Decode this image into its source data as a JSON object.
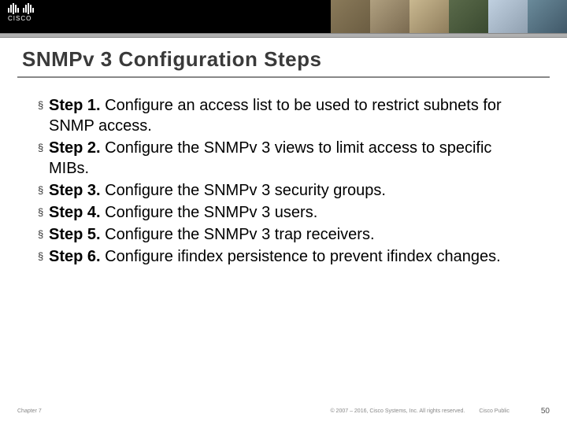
{
  "header": {
    "logo_text": "CISCO"
  },
  "title": "SNMPv 3 Configuration Steps",
  "steps": [
    {
      "label": "Step 1.",
      "body": " Configure an access list to be used to restrict subnets for SNMP access."
    },
    {
      "label": "Step 2.",
      "body": " Configure the SNMPv 3 views to limit access to specific MIBs."
    },
    {
      "label": "Step 3.",
      "body": " Configure the SNMPv 3 security groups."
    },
    {
      "label": "Step 4.",
      "body": " Configure the SNMPv 3 users."
    },
    {
      "label": "Step 5.",
      "body": " Configure the SNMPv 3 trap receivers."
    },
    {
      "label": "Step 6.",
      "body": " Configure ifindex persistence to prevent ifindex changes."
    }
  ],
  "footer": {
    "chapter": "Chapter 7",
    "copyright": "© 2007 – 2016, Cisco Systems, Inc. All rights reserved.",
    "public": "Cisco Public",
    "page": "50"
  },
  "bullet_glyph": "§"
}
